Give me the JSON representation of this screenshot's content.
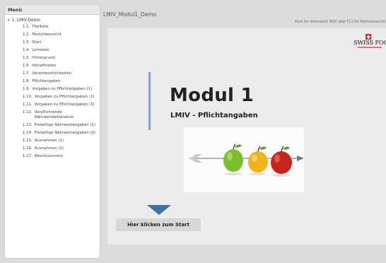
{
  "sidebar": {
    "menu_title": "Menü",
    "root": {
      "caret": "▾",
      "label": "1. LMIV-Demo"
    },
    "items": [
      {
        "num": "1.1.",
        "label": "Titelfolie"
      },
      {
        "num": "1.2.",
        "label": "Modulübersicht"
      },
      {
        "num": "1.3.",
        "label": "Start"
      },
      {
        "num": "1.4.",
        "label": "Lernziele"
      },
      {
        "num": "1.5.",
        "label": "Hintergrund"
      },
      {
        "num": "1.6.",
        "label": "Inkrafttreten"
      },
      {
        "num": "1.7.",
        "label": "Verantwortlichkeiten"
      },
      {
        "num": "1.8.",
        "label": "Pflichtangaben"
      },
      {
        "num": "1.9.",
        "label": "Vorgaben zu Pflichtangaben (1)"
      },
      {
        "num": "1.10.",
        "label": "Vorgaben zu Pflichtangaben (2)"
      },
      {
        "num": "1.11.",
        "label": "Vorgaben zu Pflichtangaben (3)"
      },
      {
        "num": "1.12.",
        "label": "Verpflichtende Nährwertdeklaration"
      },
      {
        "num": "1.13.",
        "label": "Freiwillige Nährwertangaben (1)"
      },
      {
        "num": "1.14.",
        "label": "Freiwillige Nährwertangaben (2)"
      },
      {
        "num": "1.15.",
        "label": "Ausnahmen (1)"
      },
      {
        "num": "1.16.",
        "label": "Ausnahmen (2)"
      },
      {
        "num": "1.17.",
        "label": "Abschlussnotiz"
      }
    ]
  },
  "header": {
    "module_title": "LMIV_Modul1_Demo",
    "fullscreen_hint": "Klick für Vollansicht (ESC oder F11 für Normalansicht)"
  },
  "slide": {
    "logo_text": "SWISS FOOD",
    "title": "Modul 1",
    "subtitle": "LMIV - Pflichtangaben",
    "start_button": "Hier klicken zum Start"
  },
  "colors": {
    "accent_bar": "#7fa1c9",
    "arrow": "#3f6fa4",
    "logo_red": "#d8232a"
  }
}
